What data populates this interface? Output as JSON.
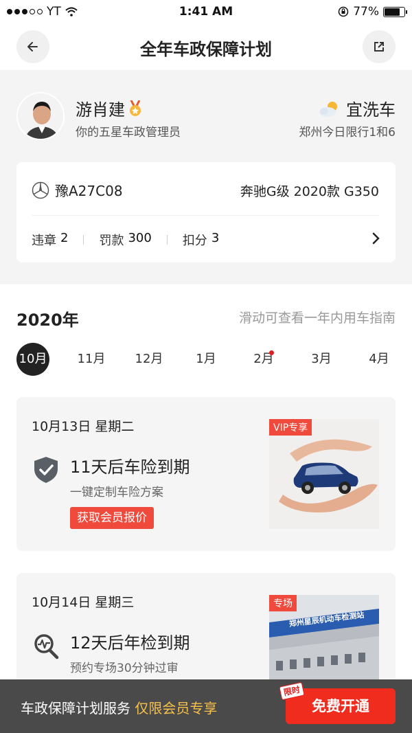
{
  "status": {
    "carrier": "YT",
    "time": "1:41 AM",
    "battery": "77%",
    "battery_level": 0.77
  },
  "nav": {
    "title": "全年车政保障计划",
    "back_icon": "arrow-left-icon",
    "share_icon": "share-external-icon"
  },
  "manager": {
    "name": "游肖建",
    "subtitle": "你的五星车政管理员",
    "badge_icon": "medal-icon"
  },
  "weather": {
    "label": "宜洗车",
    "icon": "partly-cloudy-icon",
    "restriction": "郑州今日限行1和6"
  },
  "car": {
    "brand_icon": "mercedes-logo-icon",
    "plate": "豫A27C08",
    "model": "奔驰G级 2020款 G350",
    "stats": [
      {
        "label": "违章",
        "value": "2"
      },
      {
        "label": "罚款",
        "value": "300"
      },
      {
        "label": "扣分",
        "value": "3"
      }
    ]
  },
  "plan": {
    "year": "2020年",
    "hint": "滑动可查看一年内用车指南",
    "months": [
      "10月",
      "11月",
      "12月",
      "1月",
      "2月",
      "3月",
      "4月"
    ],
    "active_month": "10月",
    "dot_month": "2月"
  },
  "tasks": [
    {
      "date": "10月13日 星期二",
      "icon": "shield-check-icon",
      "title": "11天后车险到期",
      "desc": "一键定制车险方案",
      "button": "获取会员报价",
      "badge": "VIP专享"
    },
    {
      "date": "10月14日 星期三",
      "icon": "inspection-search-icon",
      "title": "12天后年检到期",
      "desc": "预约专场30分钟过审",
      "badge": "专场",
      "sign_text": "郑州星辰机动车检测站"
    }
  ],
  "bottom": {
    "text": "车政保障计划服务 ",
    "highlight": "仅限会员专享",
    "cta": "免费开通",
    "cta_tag": "限时"
  },
  "colors": {
    "accent": "#f04a3c",
    "cta": "#f02c1e",
    "gold": "#f6c14b",
    "dark": "#222222"
  }
}
